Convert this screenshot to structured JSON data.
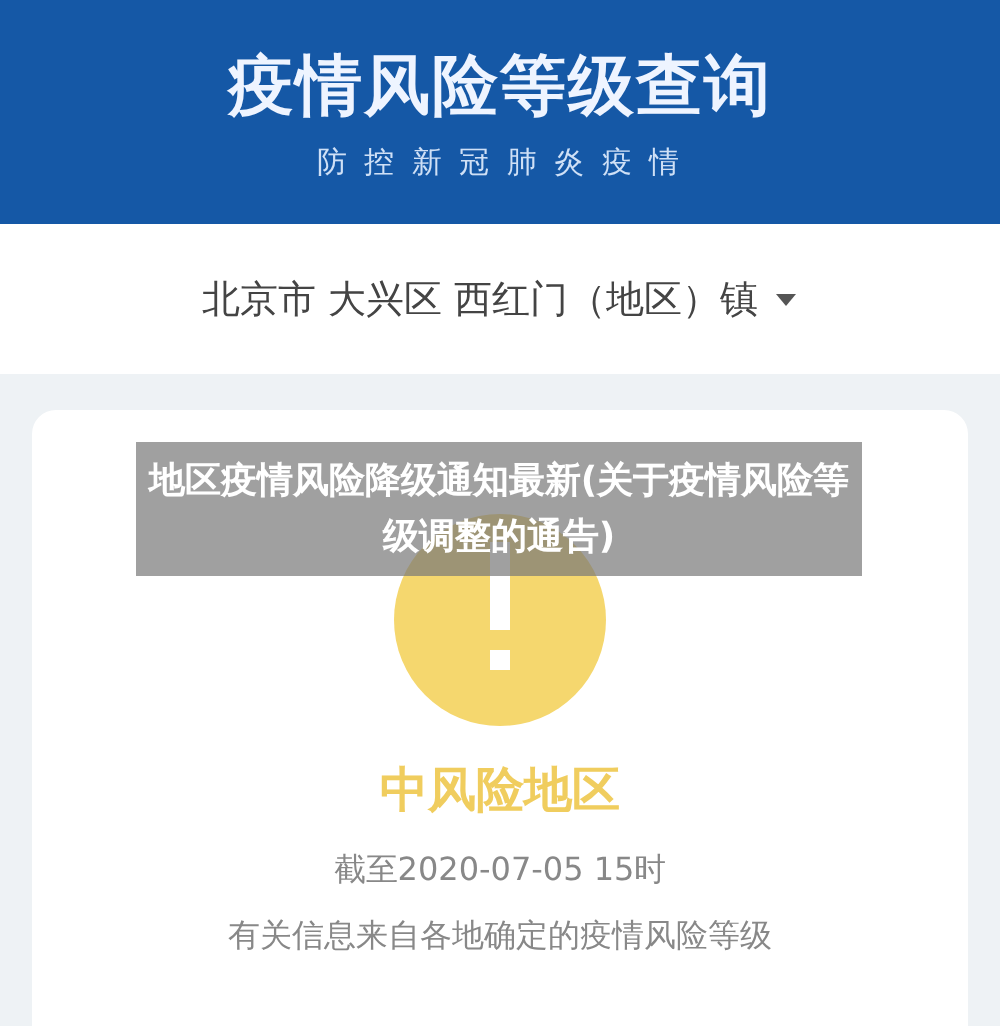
{
  "header": {
    "title": "疫情风险等级查询",
    "subtitle": "防 控 新 冠 肺 炎 疫 情"
  },
  "location": {
    "value": "北京市 大兴区 西红门（地区）镇"
  },
  "result": {
    "kind": "medium",
    "label": "中风险地区",
    "time": "截至2020-07-05 15时",
    "note": "有关信息来自各地确定的疫情风险等级"
  },
  "caption": {
    "text": "地区疫情风险降级通知最新(关于疫情风险等级调整的通告)"
  }
}
